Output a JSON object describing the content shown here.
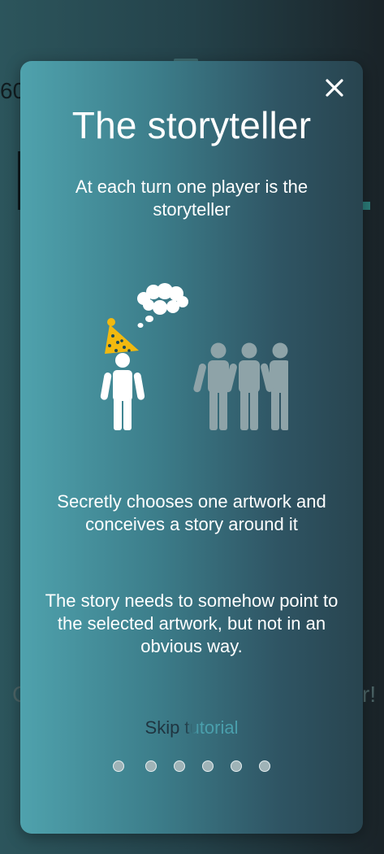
{
  "background": {
    "number_text": "60",
    "left_text": "C",
    "right_text": "r!"
  },
  "modal": {
    "close_icon": "close-icon",
    "title": "The storyteller",
    "subtitle": "At each turn one player is the storyteller",
    "paragraph_1": "Secretly chooses one artwork and conceives a story around it",
    "paragraph_2": "The story needs to somehow point to the selected artwork, but not in an obvious way.",
    "skip_label": "Skip tutorial",
    "pagination": {
      "total": 6,
      "current": 1
    }
  },
  "colors": {
    "hat": "#f2b90f",
    "hat_dots": "#1b4a57",
    "storyteller": "#ffffff",
    "players": "#8ea3a8",
    "dot": "#9fb3b7"
  }
}
